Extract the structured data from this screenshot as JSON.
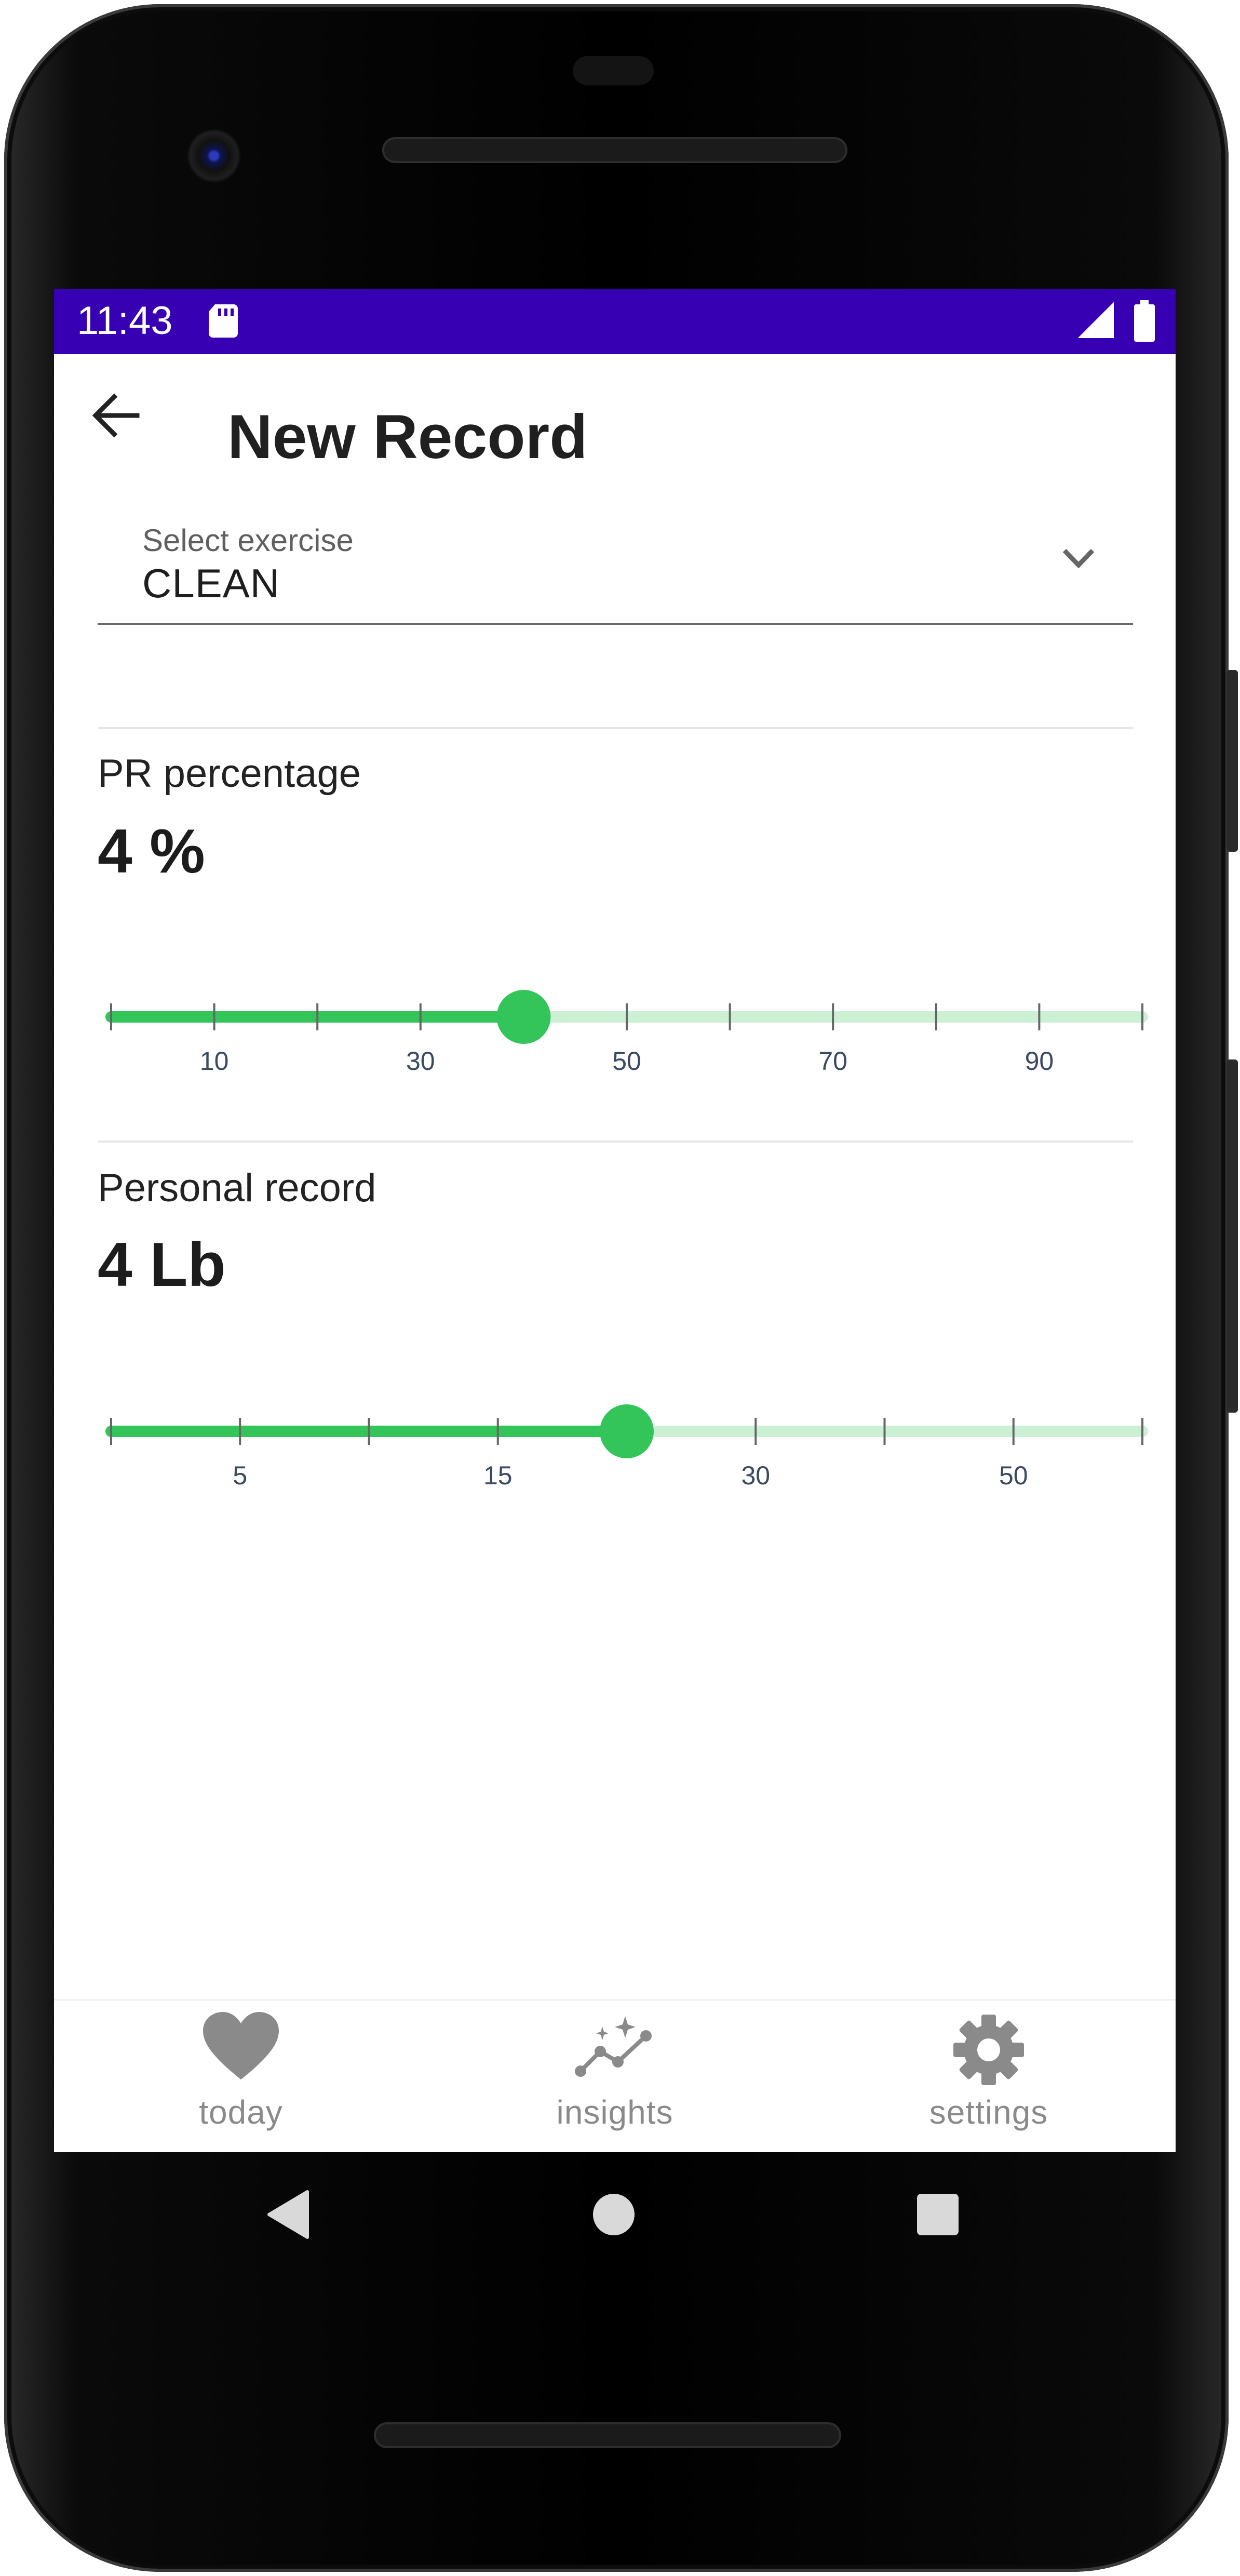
{
  "status_bar": {
    "time": "11:43"
  },
  "app_bar": {
    "title": "New Record"
  },
  "exercise_select": {
    "label": "Select exercise",
    "value": "CLEAN"
  },
  "pr_percentage": {
    "label": "PR percentage",
    "value_text": "4 %",
    "slider": {
      "min": 0,
      "max": 100,
      "step": 10,
      "value": 40,
      "tick_labels": [
        "10",
        "30",
        "50",
        "70",
        "90"
      ],
      "tick_label_values": [
        10,
        30,
        50,
        70,
        90
      ]
    }
  },
  "personal_record": {
    "label": "Personal record",
    "value_text": "4 Lb",
    "slider": {
      "tick_count": 9,
      "value_index": 4,
      "tick_labels": [
        "5",
        "15",
        "30",
        "50"
      ],
      "tick_label_indices": [
        1,
        3,
        5,
        7
      ]
    }
  },
  "bottom_nav": {
    "items": [
      {
        "label": "today",
        "icon": "heart-icon"
      },
      {
        "label": "insights",
        "icon": "insights-icon"
      },
      {
        "label": "settings",
        "icon": "gear-icon"
      }
    ]
  },
  "colors": {
    "status_bar": "#3700b3",
    "slider_active": "#34c55a",
    "slider_inactive": "#ccf0d4",
    "nav_icon": "#8a8a8a"
  }
}
